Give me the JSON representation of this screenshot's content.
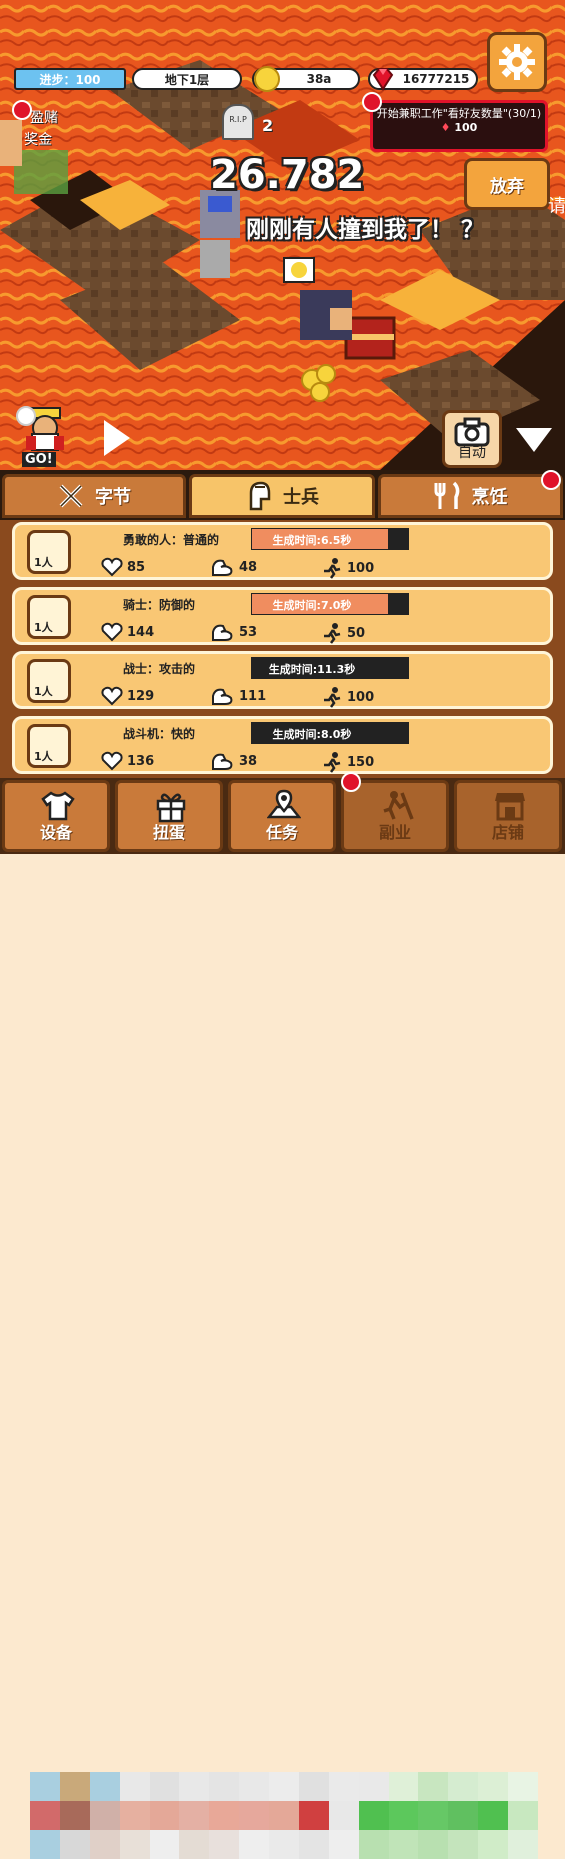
{
  "hud": {
    "progress_label": "进步：100",
    "floor_label": "地下1层",
    "gold": "38a",
    "gems": "16777215"
  },
  "quest": {
    "title": "开始兼职工作\"看好友数量\"(30/1)",
    "reward": "100"
  },
  "giveup_label": "放弃",
  "scene": {
    "damage_number": "26.782",
    "speech": "刚刚有人撞到我了！ ？",
    "rip_label": "R.I.P",
    "rip_count": "2",
    "gamble_label": "盈赌",
    "bonus_label": "奖金",
    "go_label": "GO!",
    "edge_char": "请"
  },
  "auto_label": "自动",
  "category_tabs": [
    {
      "label": "字节",
      "icon": "crossed-swords-icon"
    },
    {
      "label": "士兵",
      "icon": "spartan-helmet-icon",
      "active": true
    },
    {
      "label": "烹饪",
      "icon": "fork-knife-icon"
    }
  ],
  "soldiers": [
    {
      "name": "勇敢的人：普通的",
      "time": "生成时间:6.5秒",
      "time_progress": 0.87,
      "hp": "85",
      "str": "48",
      "speed": "100",
      "count": "1人"
    },
    {
      "name": "骑士：防御的",
      "time": "生成时间:7.0秒",
      "time_progress": 0.87,
      "hp": "144",
      "str": "53",
      "speed": "50",
      "count": "1人"
    },
    {
      "name": "战士：攻击的",
      "time": "生成时间:11.3秒",
      "time_progress": 0.0,
      "hp": "129",
      "str": "111",
      "speed": "100",
      "count": "1人"
    },
    {
      "name": "战斗机：快的",
      "time": "生成时间:8.0秒",
      "time_progress": 0.0,
      "hp": "136",
      "str": "38",
      "speed": "150",
      "count": "1人"
    }
  ],
  "nav": [
    {
      "label": "设备",
      "icon": "shirt-icon"
    },
    {
      "label": "扭蛋",
      "icon": "gift-icon"
    },
    {
      "label": "任务",
      "icon": "map-icon"
    },
    {
      "label": "副业",
      "icon": "digging-icon",
      "locked": true
    },
    {
      "label": "店铺",
      "icon": "shop-icon",
      "locked": true
    }
  ],
  "colors": {
    "lava": "#e8561e",
    "lava_light": "#f79a2e",
    "stone": "#6b4a2e",
    "accent_red": "#e0132a",
    "card_bg": "#f9c774"
  }
}
